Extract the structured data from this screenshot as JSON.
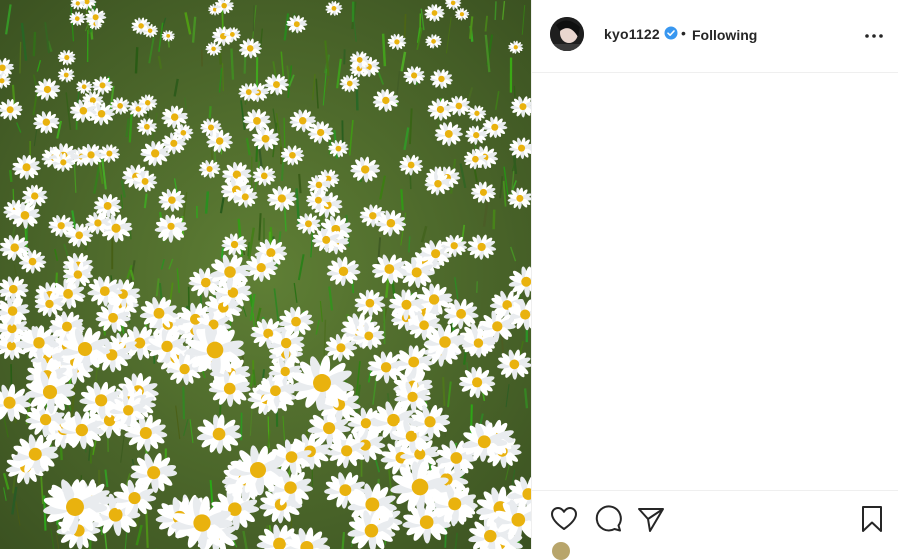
{
  "post": {
    "image_alt": "field of white daisies"
  },
  "header": {
    "username": "kyo1122",
    "separator": "•",
    "follow_status": "Following"
  },
  "icons": {
    "more": "more-options-icon",
    "like": "heart-icon",
    "comment": "comment-icon",
    "share": "send-icon",
    "save": "bookmark-icon",
    "verified": "verified-badge-icon"
  },
  "colors": {
    "verified": "#3897f0",
    "text": "#262626",
    "divider": "#efefef"
  }
}
